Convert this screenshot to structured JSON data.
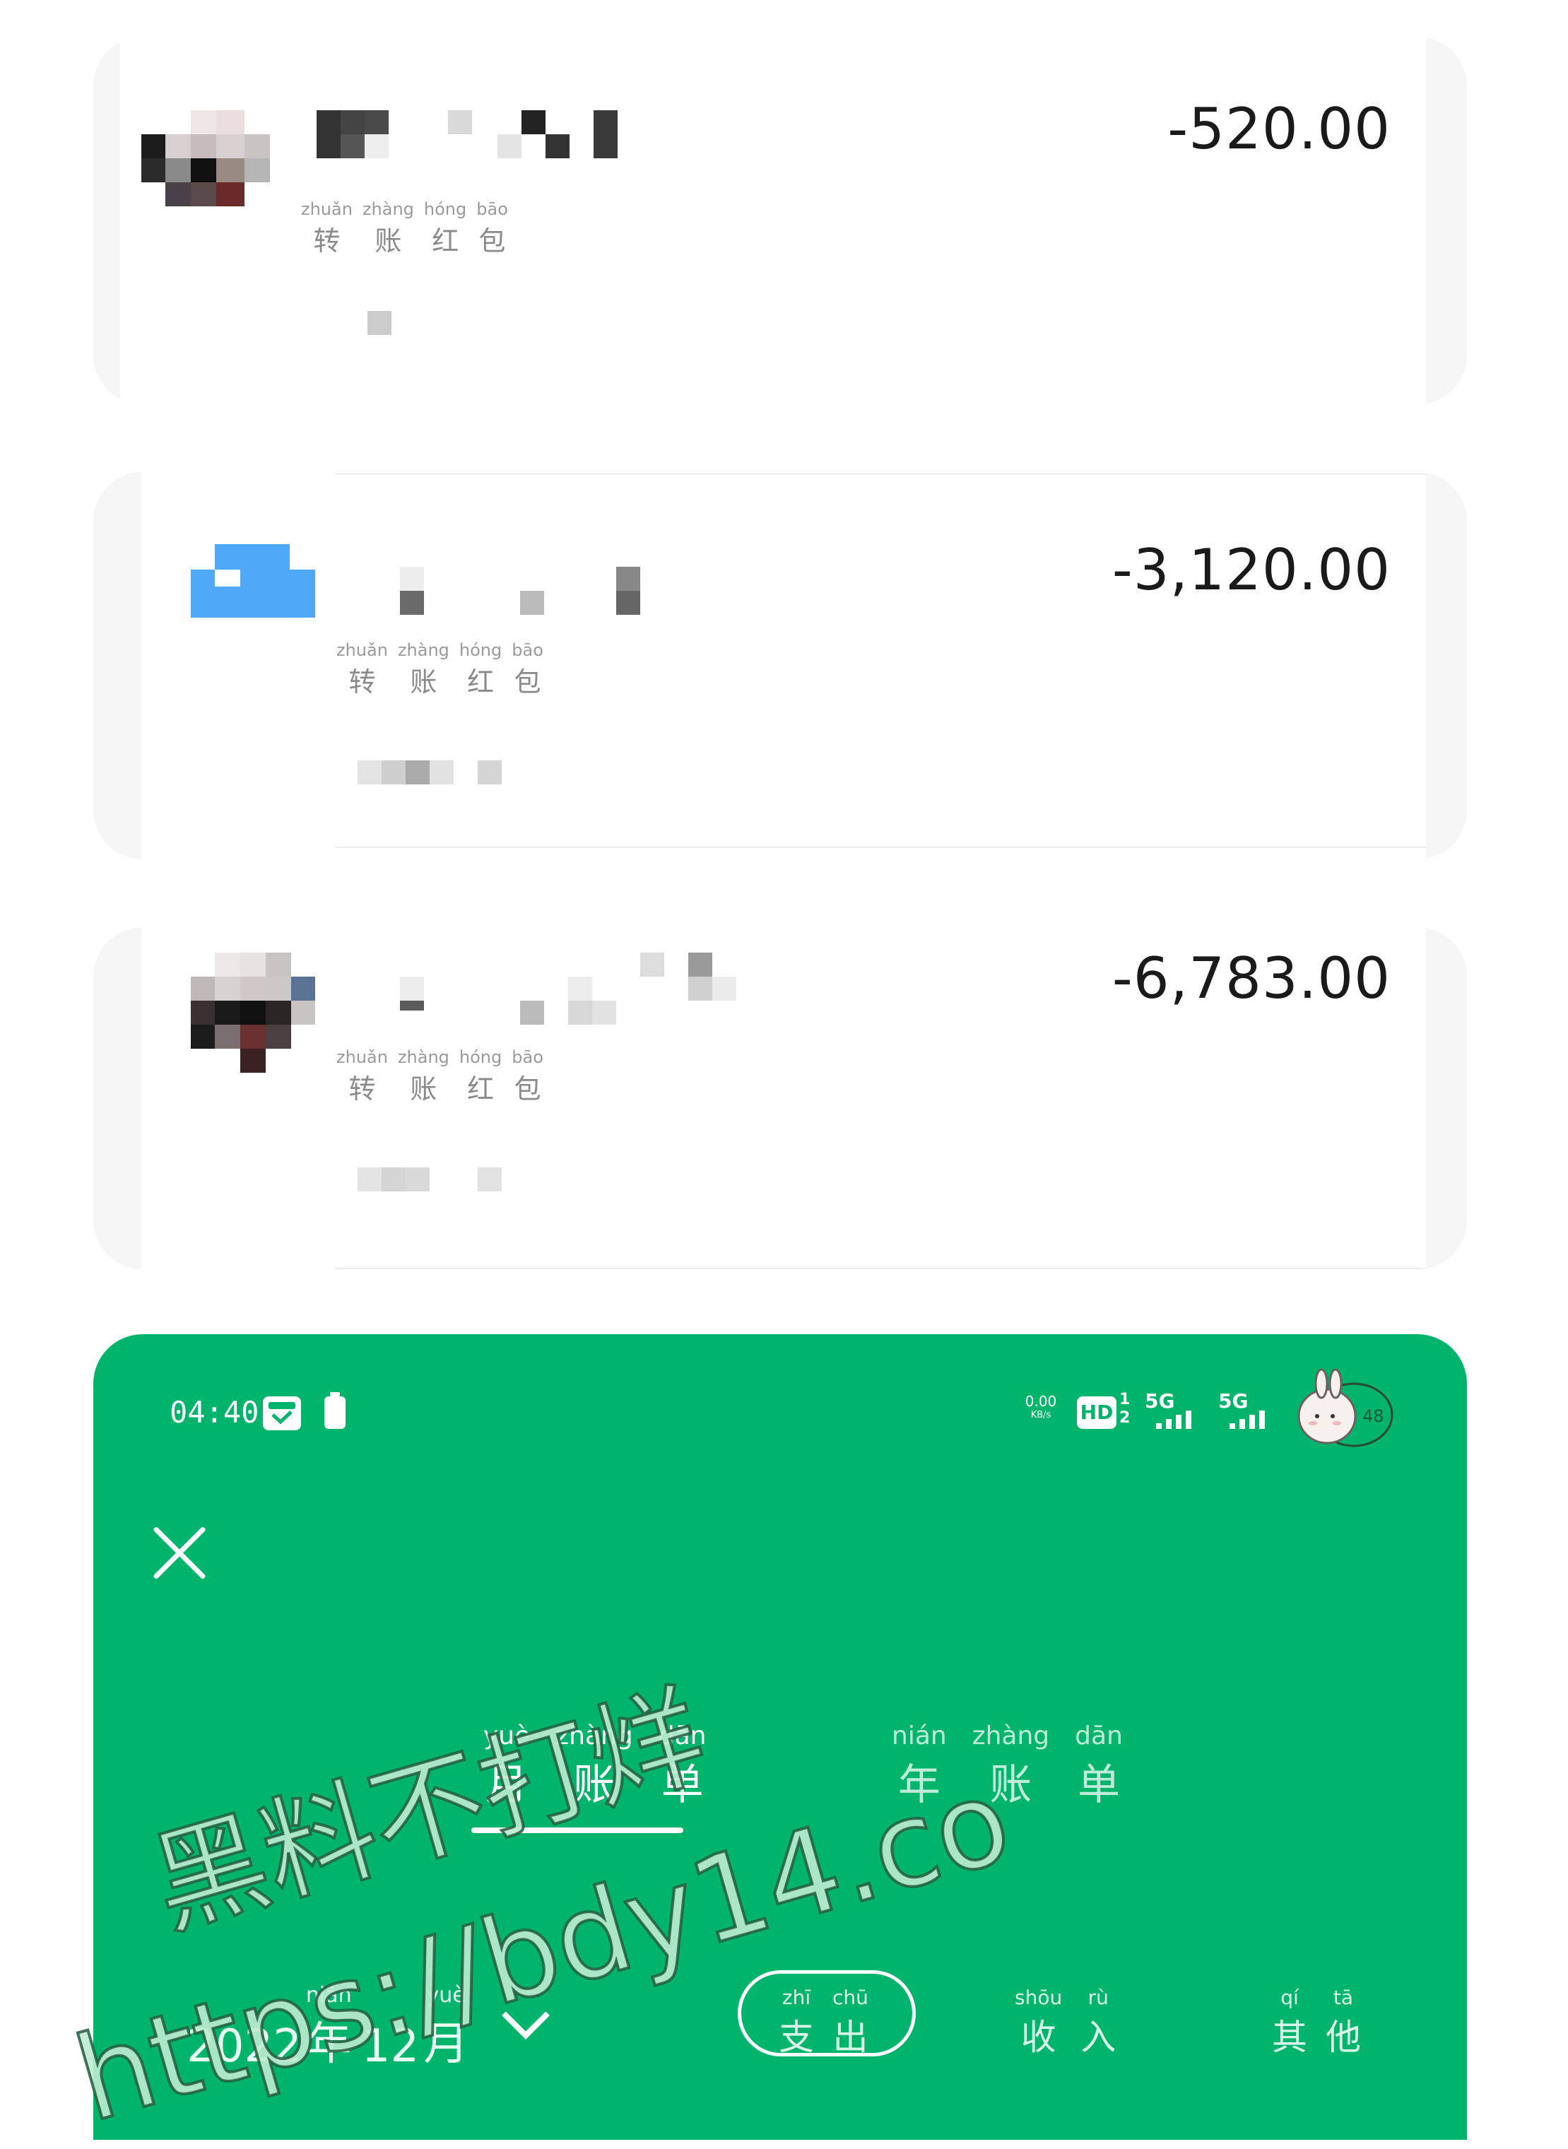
{
  "transactions": [
    {
      "amount": "-520.00",
      "type_label": {
        "pinyin": [
          "zhuǎn",
          "zhàng",
          "hóng",
          "bāo"
        ],
        "hanzi": [
          "转",
          "账",
          "红",
          "包"
        ]
      }
    },
    {
      "amount": "-3,120.00",
      "type_label": {
        "pinyin": [
          "zhuǎn",
          "zhàng",
          "hóng",
          "bāo"
        ],
        "hanzi": [
          "转",
          "账",
          "红",
          "包"
        ]
      }
    },
    {
      "amount": "-6,783.00",
      "type_label": {
        "pinyin": [
          "zhuǎn",
          "zhàng",
          "hóng",
          "bāo"
        ],
        "hanzi": [
          "转",
          "账",
          "红",
          "包"
        ]
      }
    }
  ],
  "status_bar": {
    "time": "04:40",
    "net_speed": "0.00",
    "net_unit": "KB/s",
    "hd": "HD",
    "sim1": "1",
    "sim2": "2",
    "signal1": "5G",
    "signal2": "5G",
    "battery": "48",
    "icons": [
      "wallet-app-icon",
      "battery-icon",
      "hd-icon",
      "signal-5g-icon",
      "signal-5g-icon",
      "bunny-battery-icon"
    ]
  },
  "tabs": [
    {
      "pinyin": [
        "yuè",
        "zhàng",
        "dān"
      ],
      "hanzi": [
        "月",
        "账",
        "单"
      ],
      "active": true
    },
    {
      "pinyin": [
        "nián",
        "zhàng",
        "dān"
      ],
      "hanzi": [
        "年",
        "账",
        "单"
      ],
      "active": false
    }
  ],
  "date_selector": {
    "year": "2022",
    "year_unit": {
      "pinyin": "nián",
      "hanzi": "年"
    },
    "month": "12",
    "month_unit": {
      "pinyin": "yuè",
      "hanzi": "月"
    }
  },
  "filters": [
    {
      "pinyin": [
        "zhī",
        "chū"
      ],
      "hanzi": [
        "支",
        "出"
      ],
      "selected": true
    },
    {
      "pinyin": [
        "shōu",
        "rù"
      ],
      "hanzi": [
        "收",
        "入"
      ],
      "selected": false
    },
    {
      "pinyin": [
        "qí",
        "tā"
      ],
      "hanzi": [
        "其",
        "他"
      ],
      "selected": false
    }
  ],
  "watermark": {
    "line1": "黑料不打烊",
    "line2": "https://bdy14.co"
  },
  "colors": {
    "panel_green": "#00b46b",
    "card_grey": "#f6f6f6",
    "avatar_blue": "#4fa9f8"
  }
}
